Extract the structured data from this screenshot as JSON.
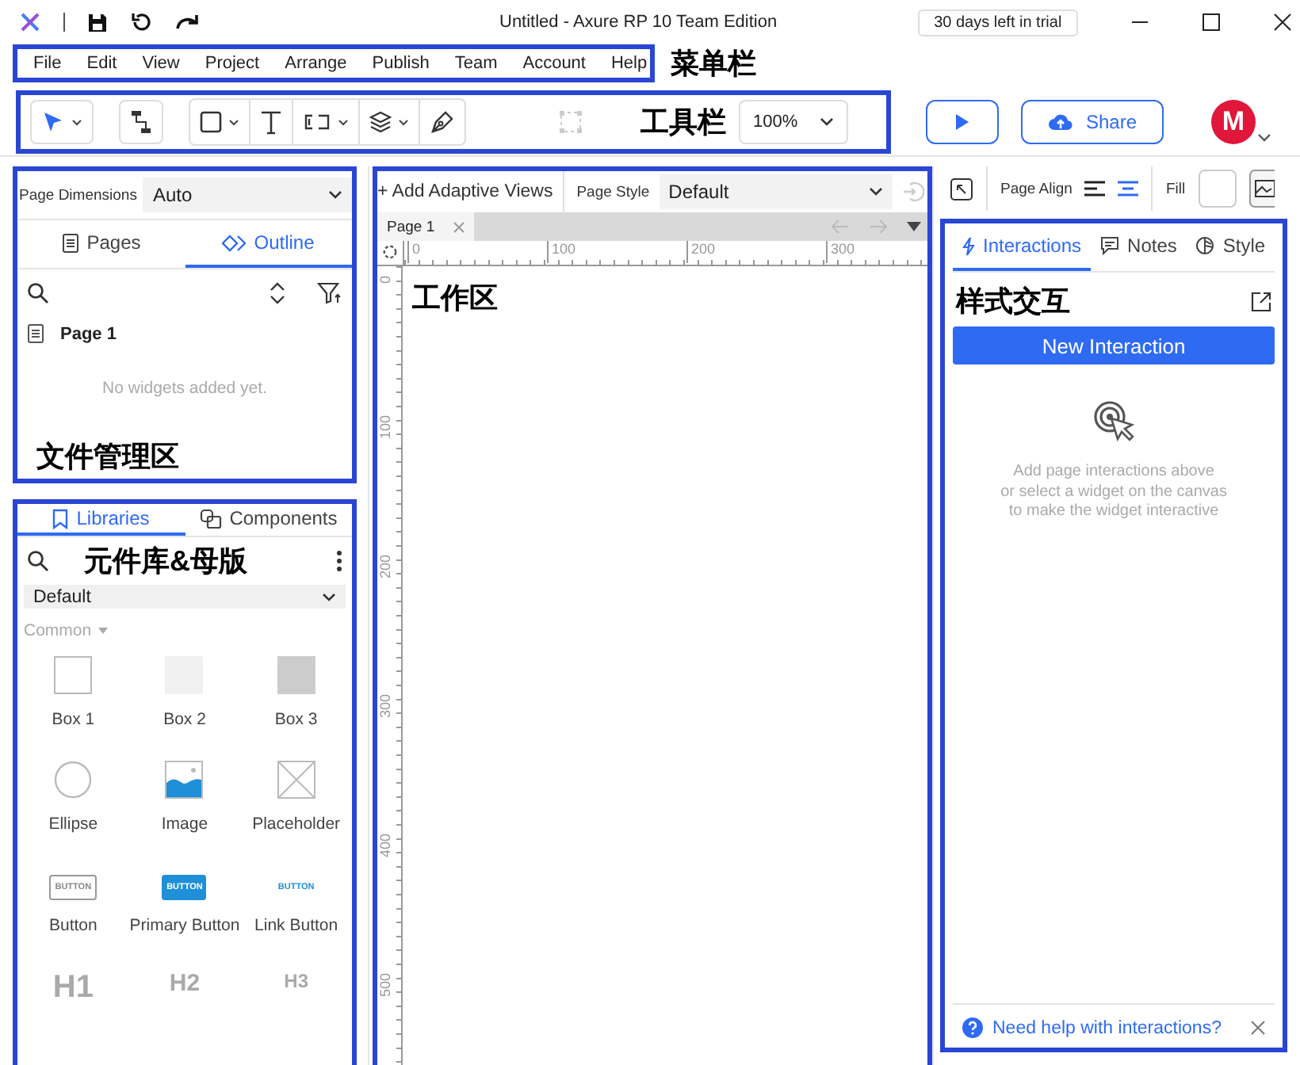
{
  "title_bar": {
    "title": "Untitled - Axure RP 10 Team Edition",
    "trial_badge": "30 days left in trial"
  },
  "menu_bar": {
    "items": [
      "File",
      "Edit",
      "View",
      "Project",
      "Arrange",
      "Publish",
      "Team",
      "Account",
      "Help"
    ],
    "annotation": "菜单栏"
  },
  "toolbar": {
    "annotation": "工具栏",
    "zoom": "100%",
    "share_button": "Share",
    "avatar": "M"
  },
  "page_panel": {
    "dimensions_label": "Page Dimensions",
    "dimensions_value": "Auto",
    "tabs": [
      {
        "label": "Pages",
        "selected": false
      },
      {
        "label": "Outline",
        "selected": true
      }
    ],
    "page": "Page 1",
    "empty_message": "No widgets added yet.",
    "annotation": "文件管理区"
  },
  "library_panel": {
    "tabs": [
      {
        "label": "Libraries",
        "selected": true
      },
      {
        "label": "Components",
        "selected": false
      }
    ],
    "annotation": "元件库&母版",
    "library": "Default",
    "category": "Common",
    "widgets": [
      {
        "kind": "box-outline",
        "label": "Box 1"
      },
      {
        "kind": "box-light",
        "label": "Box 2"
      },
      {
        "kind": "box-dark",
        "label": "Box 3"
      },
      {
        "kind": "ellipse",
        "label": "Ellipse"
      },
      {
        "kind": "image",
        "label": "Image"
      },
      {
        "kind": "placeholder",
        "label": "Placeholder"
      },
      {
        "kind": "button",
        "label": "Button",
        "sample": "BUTTON"
      },
      {
        "kind": "primary-button",
        "label": "Primary Button",
        "sample": "BUTTON"
      },
      {
        "kind": "link-button",
        "label": "Link Button",
        "sample": "BUTTON"
      },
      {
        "kind": "heading-1",
        "sample": "H1"
      },
      {
        "kind": "heading-2",
        "sample": "H2"
      },
      {
        "kind": "heading-3",
        "sample": "H3"
      }
    ]
  },
  "canvas": {
    "add_views": "+ Add Adaptive Views",
    "page_style_label": "Page Style",
    "page_style": "Default",
    "tabs": [
      {
        "label": "Page 1",
        "selected": true
      }
    ],
    "horizontal_ruler": [
      "0",
      "100",
      "200",
      "300"
    ],
    "vertical_ruler": [
      "0",
      "100",
      "200",
      "300",
      "400",
      "500"
    ],
    "annotation": "工作区"
  },
  "inspector": {
    "page_align_label": "Page Align",
    "fill_label": "Fill",
    "tabs": [
      {
        "label": "Interactions",
        "selected": true
      },
      {
        "label": "Notes",
        "selected": false
      },
      {
        "label": "Style",
        "selected": false
      }
    ],
    "annotation": "样式交互",
    "new_interaction_button": "New Interaction",
    "hint": "Add page interactions above\nor select a widget on the canvas\nto make the widget interactive",
    "help_link": "Need help with interactions?"
  }
}
